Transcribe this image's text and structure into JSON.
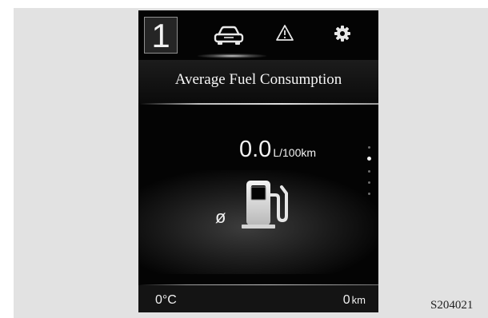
{
  "header": {
    "page_number": "1",
    "tabs": [
      {
        "icon": "car-icon",
        "active": true
      },
      {
        "icon": "warning-triangle-icon",
        "active": false
      },
      {
        "icon": "gear-icon",
        "active": false
      }
    ]
  },
  "screen": {
    "title": "Average Fuel Consumption",
    "value": "0.0",
    "unit": "L/100km",
    "average_symbol": "ø",
    "page_indicator": {
      "count": 5,
      "active_index": 1
    }
  },
  "footer": {
    "temperature": "0°C",
    "odometer_value": "0",
    "odometer_unit": "km"
  },
  "figure_code": "S204021",
  "colors": {
    "display_bg": "#040404",
    "backdrop": "#e2e2e2",
    "text": "#f2f2f2",
    "accent_glow": "#cfcfcf"
  }
}
